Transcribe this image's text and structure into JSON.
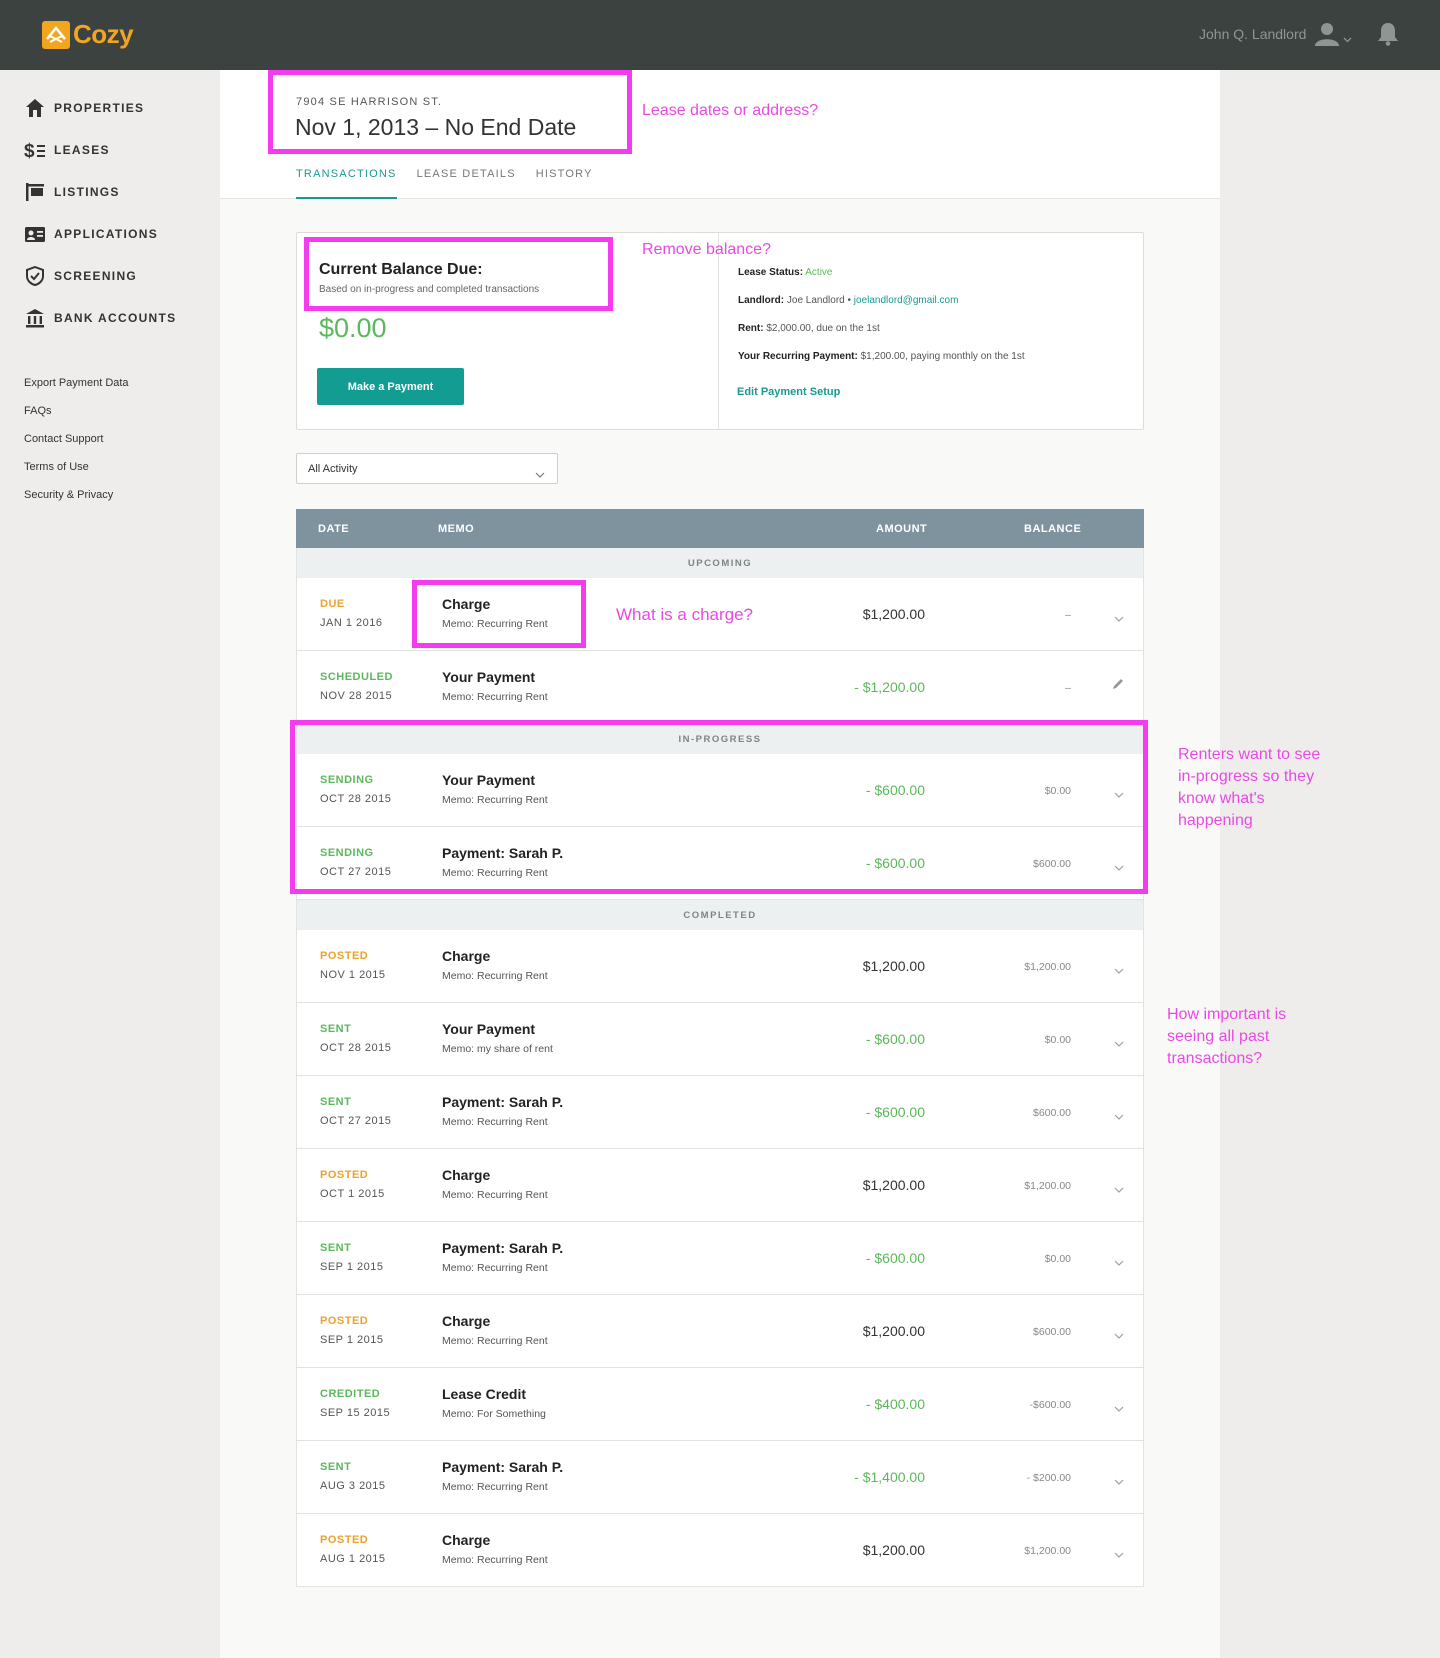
{
  "app": {
    "name": "Cozy"
  },
  "topbar": {
    "user_name": "John Q. Landlord"
  },
  "sidebar": {
    "nav": [
      {
        "label": "PROPERTIES",
        "icon": "house-icon"
      },
      {
        "label": "LEASES",
        "icon": "dollar-icon"
      },
      {
        "label": "LISTINGS",
        "icon": "sign-icon"
      },
      {
        "label": "APPLICATIONS",
        "icon": "id-card-icon"
      },
      {
        "label": "SCREENING",
        "icon": "shield-icon"
      },
      {
        "label": "BANK ACCOUNTS",
        "icon": "bank-icon"
      }
    ],
    "links": [
      "Export Payment Data",
      "FAQs",
      "Contact Support",
      "Terms of Use",
      "Security & Privacy"
    ]
  },
  "lease": {
    "address": "7904 SE HARRISON ST.",
    "dates": "Nov 1, 2013 – No End Date"
  },
  "tabs": [
    "TRANSACTIONS",
    "LEASE DETAILS",
    "HISTORY"
  ],
  "active_tab": "TRANSACTIONS",
  "balance": {
    "title": "Current Balance Due:",
    "subtitle": "Based on in-progress and completed transactions",
    "amount": "$0.00",
    "pay_button": "Make a Payment",
    "status_label": "Lease Status:",
    "status_value": "Active",
    "landlord_label": "Landlord:",
    "landlord_value": "Joe Landlord •",
    "landlord_email": "joelandlord@gmail.com",
    "rent_label": "Rent:",
    "rent_value": "$2,000.00, due on the 1st",
    "recurring_label": "Your Recurring Payment:",
    "recurring_value": "$1,200.00, paying monthly on the 1st",
    "edit_link": "Edit Payment Setup"
  },
  "filter": {
    "value": "All Activity"
  },
  "table": {
    "headers": {
      "date": "DATE",
      "memo": "MEMO",
      "amount": "AMOUNT",
      "balance": "BALANCE"
    },
    "sections": {
      "upcoming": "UPCOMING",
      "in_progress": "IN-PROGRESS",
      "completed": "COMPLETED"
    },
    "upcoming": [
      {
        "status": "DUE",
        "date": "JAN 1 2016",
        "title": "Charge",
        "memo": "Memo: Recurring Rent",
        "amount": "$1,200.00",
        "balance": "–"
      },
      {
        "status": "SCHEDULED",
        "date": "NOV 28 2015",
        "title": "Your Payment",
        "memo": "Memo: Recurring Rent",
        "amount": "- $1,200.00",
        "balance": "–"
      }
    ],
    "in_progress": [
      {
        "status": "SENDING",
        "date": "OCT 28 2015",
        "title": "Your Payment",
        "memo": "Memo: Recurring Rent",
        "amount": "- $600.00",
        "balance": "$0.00"
      },
      {
        "status": "SENDING",
        "date": "OCT 27 2015",
        "title": "Payment: Sarah P.",
        "memo": "Memo: Recurring Rent",
        "amount": "- $600.00",
        "balance": "$600.00"
      }
    ],
    "completed": [
      {
        "status": "POSTED",
        "date": "NOV 1 2015",
        "title": "Charge",
        "memo": "Memo: Recurring Rent",
        "amount": "$1,200.00",
        "balance": "$1,200.00"
      },
      {
        "status": "SENT",
        "date": "OCT 28 2015",
        "title": "Your Payment",
        "memo": "Memo: my share of rent",
        "amount": "- $600.00",
        "balance": "$0.00"
      },
      {
        "status": "SENT",
        "date": "OCT 27 2015",
        "title": "Payment: Sarah P.",
        "memo": "Memo: Recurring Rent",
        "amount": "- $600.00",
        "balance": "$600.00"
      },
      {
        "status": "POSTED",
        "date": "OCT 1 2015",
        "title": "Charge",
        "memo": "Memo: Recurring Rent",
        "amount": "$1,200.00",
        "balance": "$1,200.00"
      },
      {
        "status": "SENT",
        "date": "SEP 1 2015",
        "title": "Payment: Sarah P.",
        "memo": "Memo: Recurring Rent",
        "amount": "- $600.00",
        "balance": "$0.00"
      },
      {
        "status": "POSTED",
        "date": "SEP 1 2015",
        "title": "Charge",
        "memo": "Memo: Recurring Rent",
        "amount": "$1,200.00",
        "balance": "$600.00"
      },
      {
        "status": "CREDITED",
        "date": "SEP 15 2015",
        "title": "Lease Credit",
        "memo": "Memo: For Something",
        "amount": "- $400.00",
        "balance": "-$600.00"
      },
      {
        "status": "SENT",
        "date": "AUG 3 2015",
        "title": "Payment: Sarah P.",
        "memo": "Memo: Recurring Rent",
        "amount": "- $1,400.00",
        "balance": "- $200.00"
      },
      {
        "status": "POSTED",
        "date": "AUG 1 2015",
        "title": "Charge",
        "memo": "Memo: Recurring Rent",
        "amount": "$1,200.00",
        "balance": "$1,200.00"
      }
    ]
  },
  "annotations": {
    "lease_header": "Lease dates or address?",
    "balance": "Remove balance?",
    "charge": "What is a charge?",
    "in_progress_lines": [
      "Renters want to see",
      "in-progress so they",
      "know what's",
      "happening"
    ],
    "past_lines": [
      "How important is",
      "seeing all past",
      "transactions?"
    ]
  },
  "colors": {
    "topbar": "#3c4240",
    "brand": "#f2a51f",
    "accent": "#139c92",
    "positive": "#5cb85c",
    "status_orange": "#eba22c",
    "annotation": "#f43bf0",
    "table_header": "#7f939f"
  }
}
